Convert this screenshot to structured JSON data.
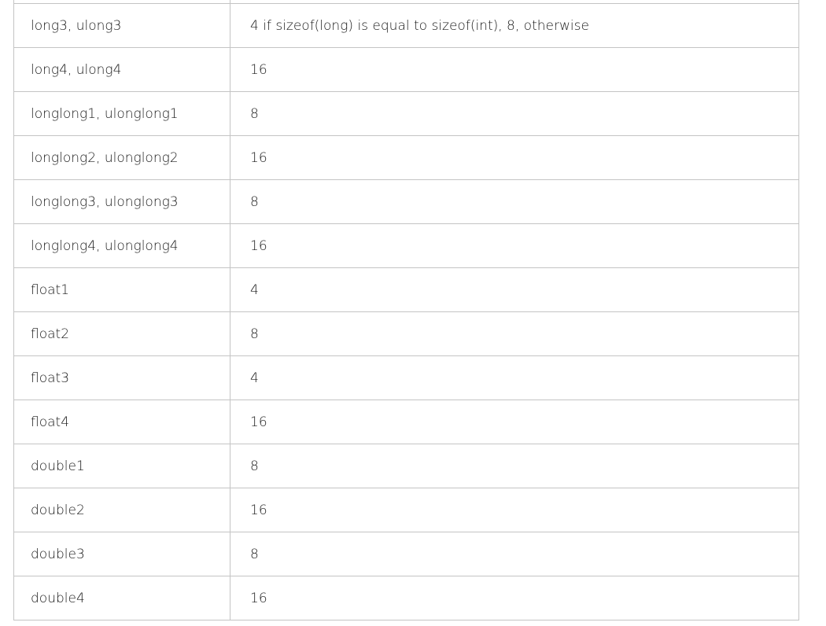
{
  "table": {
    "rows": [
      {
        "type": "",
        "alignment": ""
      },
      {
        "type": "long3, ulong3",
        "alignment": "4 if sizeof(long) is equal to sizeof(int), 8, otherwise"
      },
      {
        "type": "long4, ulong4",
        "alignment": "16"
      },
      {
        "type": "longlong1, ulonglong1",
        "alignment": "8"
      },
      {
        "type": "longlong2, ulonglong2",
        "alignment": "16"
      },
      {
        "type": "longlong3, ulonglong3",
        "alignment": "8"
      },
      {
        "type": "longlong4, ulonglong4",
        "alignment": "16"
      },
      {
        "type": "float1",
        "alignment": "4"
      },
      {
        "type": "float2",
        "alignment": "8"
      },
      {
        "type": "float3",
        "alignment": "4"
      },
      {
        "type": "float4",
        "alignment": "16"
      },
      {
        "type": "double1",
        "alignment": "8"
      },
      {
        "type": "double2",
        "alignment": "16"
      },
      {
        "type": "double3",
        "alignment": "8"
      },
      {
        "type": "double4",
        "alignment": "16"
      }
    ]
  }
}
